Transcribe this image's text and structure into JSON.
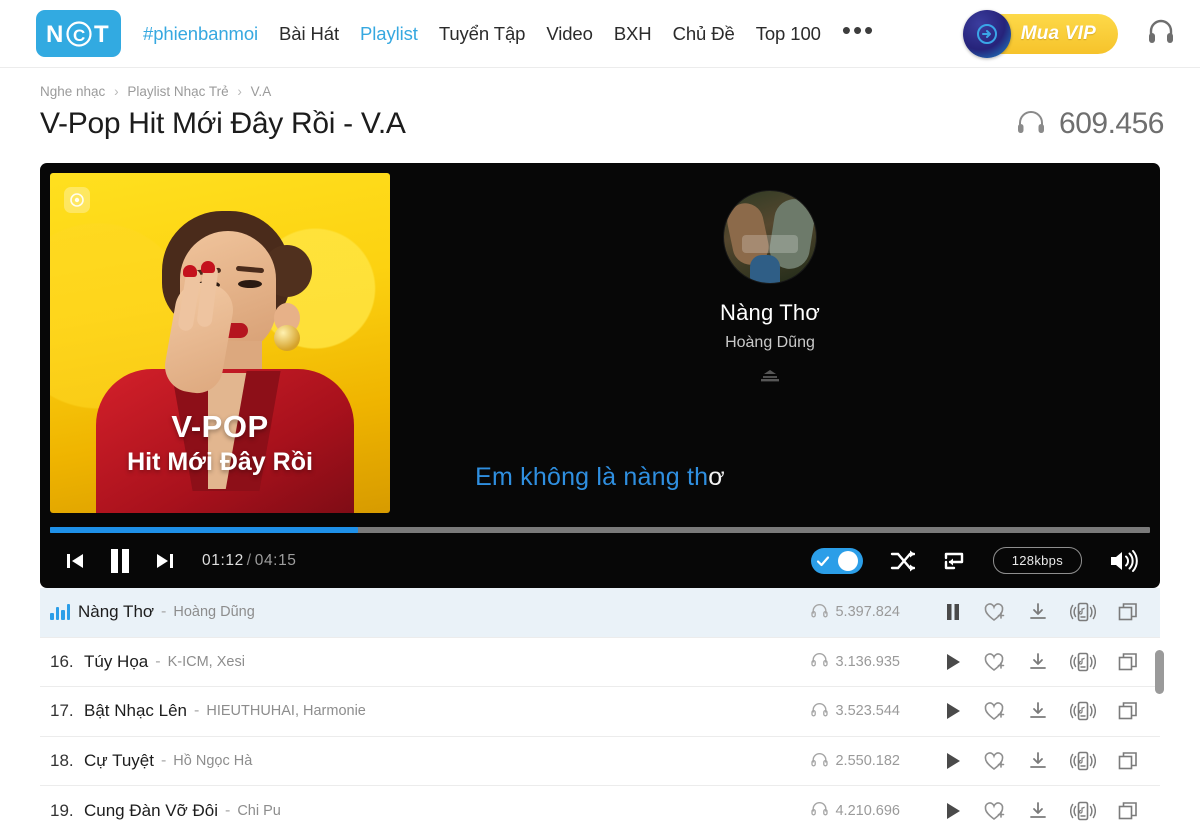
{
  "header": {
    "logo_alt": "NCT",
    "nav": [
      {
        "label": "#phienbanmoi",
        "active": true
      },
      {
        "label": "Bài Hát",
        "active": false
      },
      {
        "label": "Playlist",
        "active": true
      },
      {
        "label": "Tuyển Tập",
        "active": false
      },
      {
        "label": "Video",
        "active": false
      },
      {
        "label": "BXH",
        "active": false
      },
      {
        "label": "Chủ Đề",
        "active": false
      },
      {
        "label": "Top 100",
        "active": false
      }
    ],
    "more_label": "•••",
    "vip_button": "Mua VIP",
    "headphone_icon": "headphone-icon"
  },
  "breadcrumb": {
    "items": [
      "Nghe nhạc",
      "Playlist Nhạc Trẻ",
      "V.A"
    ],
    "separator": "›"
  },
  "page": {
    "title": "V-Pop Hit Mới Đây Rồi - V.A",
    "listen_count": "609.456"
  },
  "cover": {
    "line1": "V-POP",
    "line2": "Hit Mới Đây Rồi",
    "badge_icon": "nct-badge-icon"
  },
  "player": {
    "now_playing_title": "Nàng Thơ",
    "now_playing_artist": "Hoàng Dũng",
    "lyric_highlight": "Em không là nàng th",
    "lyric_rest": "ơ",
    "current_time": "01:12",
    "time_separator": "/",
    "total_time": "04:15",
    "progress_percent": 28,
    "bitrate": "128kbps",
    "icons": {
      "prev": "previous-track-icon",
      "pause": "pause-icon",
      "next": "next-track-icon",
      "karaoke_toggle": "karaoke-toggle",
      "shuffle": "shuffle-icon",
      "repeat": "repeat-icon",
      "volume": "volume-icon",
      "collapse": "collapse-chevron-icon"
    },
    "colors": {
      "accent": "#1e90e8",
      "panel_bg": "#070707",
      "lyric_highlight": "#2f8fe0"
    }
  },
  "tracklist": {
    "row_icons": {
      "play": "play-icon",
      "pause": "pause-icon",
      "favorite": "heart-plus-icon",
      "download": "download-icon",
      "ringtone": "ringtone-icon",
      "copy": "copy-icon",
      "plays": "headphone-icon",
      "equalizer": "equalizer-icon"
    },
    "tracks": [
      {
        "index": "",
        "name": "Nàng Thơ",
        "artist": "Hoàng Dũng",
        "plays": "5.397.824",
        "playing": true
      },
      {
        "index": "16.",
        "name": "Túy Họa",
        "artist": "K-ICM,  Xesi",
        "plays": "3.136.935",
        "playing": false
      },
      {
        "index": "17.",
        "name": "Bật Nhạc Lên",
        "artist": "HIEUTHUHAI,  Harmonie",
        "plays": "3.523.544",
        "playing": false
      },
      {
        "index": "18.",
        "name": "Cự Tuyệt",
        "artist": "Hồ Ngọc Hà",
        "plays": "2.550.182",
        "playing": false
      },
      {
        "index": "19.",
        "name": "Cung Đàn Vỡ Đôi",
        "artist": "Chi Pu",
        "plays": "4.210.696",
        "playing": false
      }
    ]
  }
}
